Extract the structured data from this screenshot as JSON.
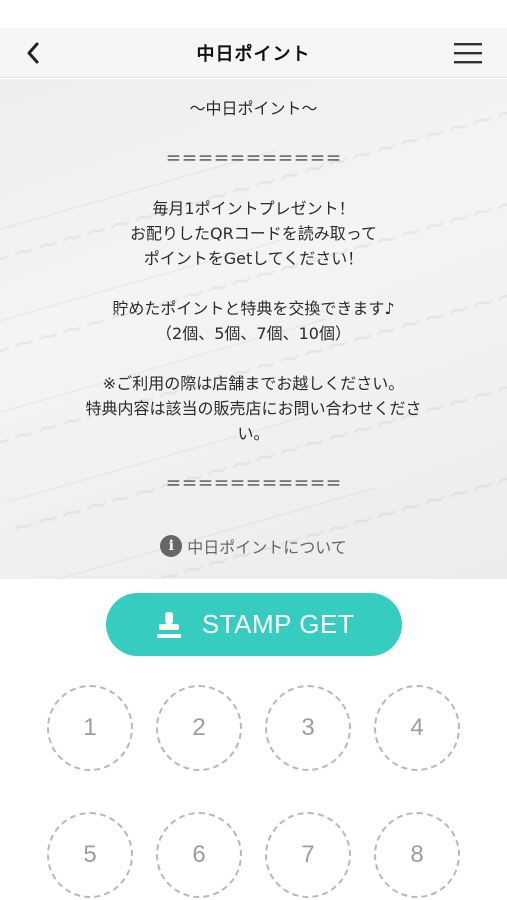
{
  "header": {
    "title": "中日ポイント",
    "back_icon": "chevron-left-icon",
    "menu_icon": "hamburger-menu-icon"
  },
  "info": {
    "lines": [
      "～中日ポイント～",
      "",
      "＝＝＝＝＝＝＝＝＝＝＝",
      "",
      "毎月1ポイントプレゼント！",
      "お配りしたQRコードを読み取って",
      "ポイントをGetしてください！",
      "",
      "貯めたポイントと特典を交換できます♪",
      "（2個、5個、7個、10個）",
      "",
      "※ご利用の際は店舗までお越しください。",
      "特典内容は該当の販売店にお問い合わせくださ",
      "い。",
      "",
      "＝＝＝＝＝＝＝＝＝＝＝"
    ],
    "about_link": "中日ポイントについて"
  },
  "stamp_button": {
    "label": "STAMP GET"
  },
  "stamps": [
    "1",
    "2",
    "3",
    "4",
    "5",
    "6",
    "7",
    "8"
  ],
  "colors": {
    "accent": "#37ccc0",
    "slot_border": "#b8b8b8"
  }
}
